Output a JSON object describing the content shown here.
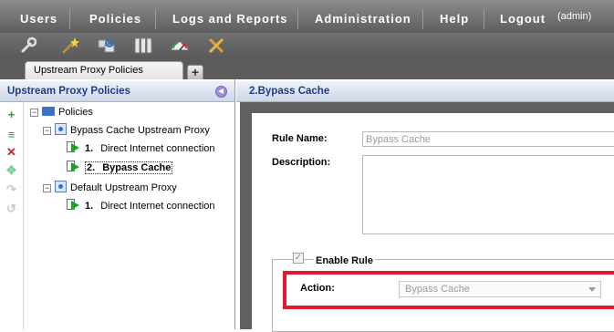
{
  "menu": {
    "users": "Users",
    "policies": "Policies",
    "logs_reports": "Logs and Reports",
    "administration": "Administration",
    "help": "Help",
    "logout": "Logout",
    "admin_user": "(admin)"
  },
  "toolbar": {
    "icons": [
      "wrench-icon",
      "magic-wand-icon",
      "network-search-icon",
      "servers-icon",
      "dashboard-gauge-icon",
      "tools-icon"
    ]
  },
  "tabs": {
    "active": "Upstream Proxy Policies",
    "add": "+"
  },
  "left_panel": {
    "title": "Upstream Proxy Policies",
    "tree": {
      "root": "Policies",
      "groups": [
        {
          "name": "Bypass Cache Upstream Proxy",
          "expander": "−",
          "rules": [
            {
              "num": "1.",
              "label": "Direct Internet connection"
            },
            {
              "num": "2.",
              "label": "Bypass Cache"
            }
          ]
        },
        {
          "name": "Default Upstream Proxy",
          "expander": "−",
          "rules": [
            {
              "num": "1.",
              "label": "Direct Internet connection"
            }
          ]
        }
      ],
      "root_expander": "−"
    }
  },
  "right_panel": {
    "title": "2.Bypass Cache",
    "rule_name_label": "Rule Name:",
    "rule_name_value": "Bypass Cache",
    "description_label": "Description:",
    "description_value": "",
    "enable_rule_label": "Enable Rule",
    "enable_rule_checked": true,
    "check_mark": "✓",
    "action_label": "Action:",
    "action_value": "Bypass Cache"
  },
  "colors": {
    "menu_bg": "#6e6e6e",
    "header_text": "#1e3c8c",
    "highlight": "#e0192e",
    "rule_arrow": "#19a12c"
  }
}
